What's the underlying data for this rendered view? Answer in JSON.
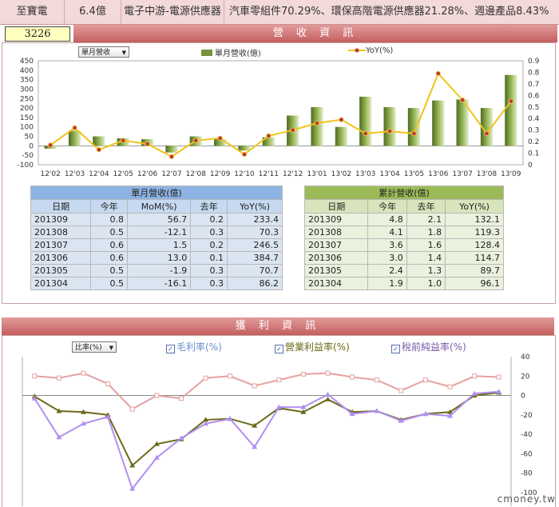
{
  "topbar": {
    "company": "至寶電",
    "capital": "6.4億",
    "industry": "電子中游-電源供應器",
    "products": "汽車零組件70.29%、環保高階電源供應器21.28%、週邊產品8.43%"
  },
  "stock_code": "3226",
  "revenue_section": {
    "title": "營 收 資 訊",
    "dropdown": "單月營收",
    "legend_bar": "單月營收(億)",
    "legend_line": "YoY(%)"
  },
  "profit_section": {
    "title": "獲 利 資 訊",
    "dropdown": "比率(%)",
    "legend_gross": "毛利率(%)",
    "legend_operating": "營業利益率(%)",
    "legend_pretax": "稅前純益率(%)"
  },
  "colors": {
    "bar": "#77933c",
    "yoy": "#f0c419",
    "yoy_marker": "#c0392b",
    "gross": "#e6a0a0",
    "operating": "#6b6b1a",
    "pretax": "#b28ef0"
  },
  "chart_data": [
    {
      "type": "bar",
      "title": "",
      "categories": [
        "12'02",
        "12'03",
        "12'04",
        "12'05",
        "12'06",
        "12'07",
        "12'08",
        "12'09",
        "12'10",
        "12'11",
        "12'12",
        "13'01",
        "13'02",
        "13'03",
        "13'04",
        "13'05",
        "13'06",
        "13'07",
        "13'08",
        "13'09"
      ],
      "ylim": [
        -100,
        450
      ],
      "y_ticks": [
        -100,
        -50,
        0,
        50,
        100,
        150,
        200,
        250,
        300,
        350,
        400,
        450
      ],
      "y2lim": [
        0,
        0.9
      ],
      "y2_ticks": [
        0,
        0.1,
        0.2,
        0.3,
        0.4,
        0.5,
        0.6,
        0.7,
        0.8,
        0.9
      ],
      "series": [
        {
          "name": "單月營收(億)",
          "axis": "left",
          "values": [
            -15,
            80,
            50,
            40,
            35,
            -35,
            50,
            35,
            -25,
            45,
            160,
            205,
            100,
            260,
            205,
            200,
            240,
            245,
            200,
            375
          ]
        },
        {
          "name": "YoY(%)",
          "axis": "right",
          "values": [
            0.17,
            0.32,
            0.13,
            0.21,
            0.18,
            0.07,
            0.21,
            0.23,
            0.09,
            0.25,
            0.3,
            0.36,
            0.39,
            0.27,
            0.29,
            0.27,
            0.79,
            0.56,
            0.27,
            0.55
          ]
        }
      ]
    },
    {
      "type": "line",
      "title": "",
      "points_count": 20,
      "ylim": [
        -100,
        40
      ],
      "y_ticks": [
        40,
        20,
        0,
        -20,
        -40,
        -60,
        -80,
        -100
      ],
      "series": [
        {
          "name": "毛利率(%)",
          "values": [
            20,
            18,
            23,
            12,
            -14,
            0,
            -3,
            18,
            20,
            10,
            16,
            22,
            23,
            19,
            16,
            5,
            16,
            9,
            20,
            19
          ]
        },
        {
          "name": "營業利益率(%)",
          "values": [
            -1,
            -16,
            -17,
            -20,
            -72,
            -50,
            -45,
            -25,
            -24,
            -31,
            -13,
            -17,
            -4,
            -17,
            -16,
            -25,
            -19,
            -17,
            0,
            3
          ]
        },
        {
          "name": "稅前純益率(%)",
          "values": [
            -3,
            -43,
            -29,
            -22,
            -96,
            -64,
            -44,
            -29,
            -24,
            -53,
            -12,
            -12,
            1,
            -19,
            -16,
            -26,
            -19,
            -21,
            2,
            4
          ]
        }
      ]
    }
  ],
  "monthly_table": {
    "caption": "單月營收(億)",
    "headers": [
      "日期",
      "今年",
      "MoM(%)",
      "去年",
      "YoY(%)"
    ],
    "rows": [
      [
        "201309",
        "0.8",
        "56.7",
        "0.2",
        "233.4"
      ],
      [
        "201308",
        "0.5",
        "-12.1",
        "0.3",
        "70.3"
      ],
      [
        "201307",
        "0.6",
        "1.5",
        "0.2",
        "246.5"
      ],
      [
        "201306",
        "0.6",
        "13.0",
        "0.1",
        "384.7"
      ],
      [
        "201305",
        "0.5",
        "-1.9",
        "0.3",
        "70.7"
      ],
      [
        "201304",
        "0.5",
        "-16.1",
        "0.3",
        "86.2"
      ]
    ]
  },
  "cumulative_table": {
    "caption": "累計營收(億)",
    "headers": [
      "日期",
      "今年",
      "去年",
      "YoY(%)"
    ],
    "rows": [
      [
        "201309",
        "4.8",
        "2.1",
        "132.1"
      ],
      [
        "201308",
        "4.1",
        "1.8",
        "119.3"
      ],
      [
        "201307",
        "3.6",
        "1.6",
        "128.4"
      ],
      [
        "201306",
        "3.0",
        "1.4",
        "114.7"
      ],
      [
        "201305",
        "2.4",
        "1.3",
        "89.7"
      ],
      [
        "201304",
        "1.9",
        "1.0",
        "96.1"
      ]
    ]
  },
  "watermark": "cmoney.tw"
}
